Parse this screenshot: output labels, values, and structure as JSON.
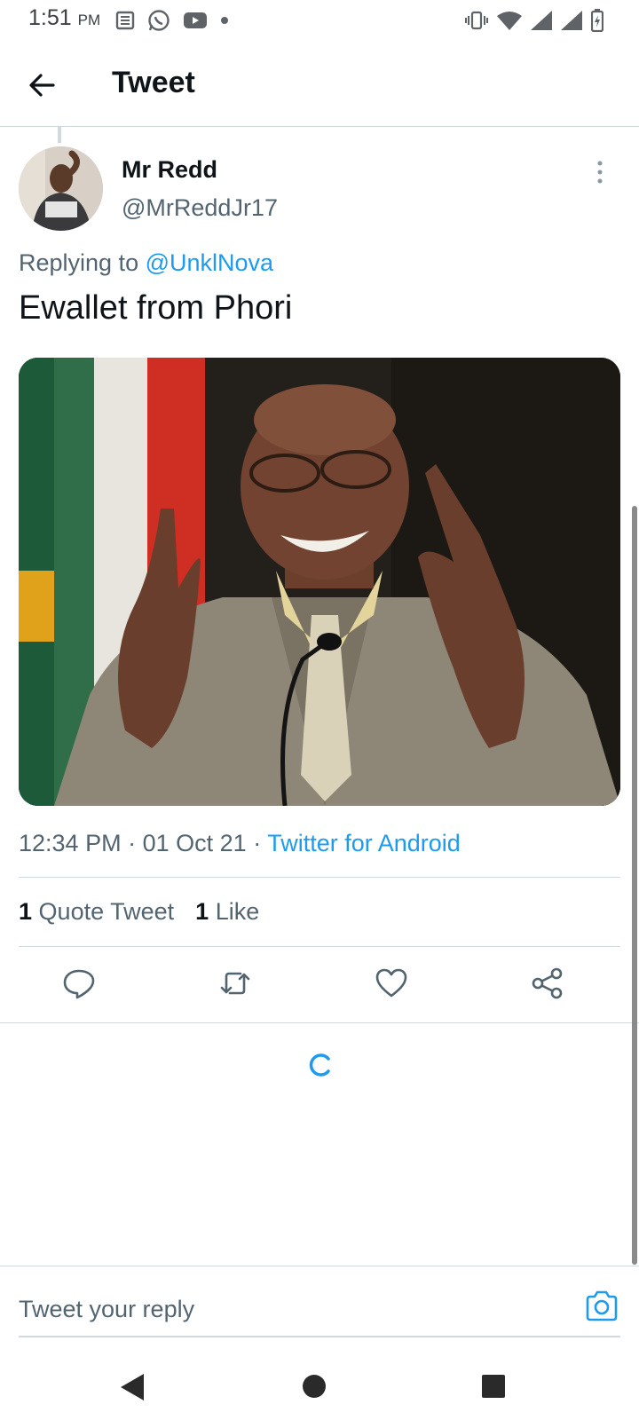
{
  "status_bar": {
    "time": "1:51",
    "ampm": "PM"
  },
  "header": {
    "title": "Tweet"
  },
  "tweet": {
    "author_name": "Mr Redd",
    "author_handle": "@MrReddJr17",
    "replying_to_prefix": "Replying to",
    "replying_to_handle": "@UnklNova",
    "text": "Ewallet from Phori",
    "time": "12:34 PM",
    "date": "01 Oct 21",
    "source": "Twitter for Android",
    "stats": {
      "quote_count": "1",
      "quote_label": "Quote Tweet",
      "like_count": "1",
      "like_label": "Like"
    }
  },
  "reply": {
    "placeholder": "Tweet your reply"
  },
  "colors": {
    "accent": "#1d9bf0",
    "text": "#0f1419",
    "secondary": "#536471",
    "divider": "#cfd9de"
  },
  "icons": [
    "back-arrow-icon",
    "more-vertical-icon",
    "reply-icon",
    "retweet-icon",
    "like-icon",
    "share-icon",
    "camera-icon",
    "loading-spinner-icon"
  ]
}
